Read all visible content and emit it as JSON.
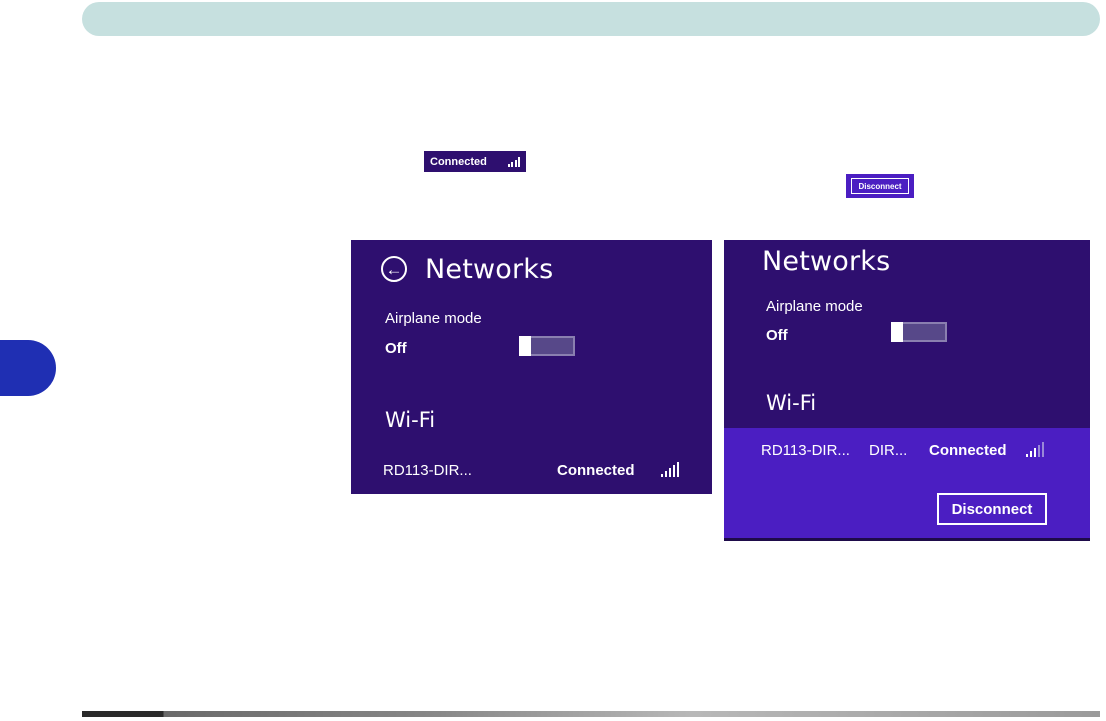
{
  "chips": {
    "connected_label": "Connected",
    "disconnect_label": "Disconnect"
  },
  "left_panel": {
    "title": "Networks",
    "back_icon": "back-arrow-circle-icon",
    "airplane_label": "Airplane mode",
    "airplane_state": "Off",
    "wifi_heading": "Wi-Fi",
    "network_name": "RD113-DIR...",
    "network_status": "Connected"
  },
  "right_panel": {
    "title": "Networks",
    "airplane_label": "Airplane mode",
    "airplane_state": "Off",
    "wifi_heading": "Wi-Fi",
    "network_name": "RD113-DIR...",
    "network_extra": "DIR...",
    "network_status": "Connected",
    "disconnect_label": "Disconnect"
  },
  "colors": {
    "panel_bg": "#2e0f6f",
    "selected_bg": "#4b1ec2",
    "header_bar": "#c6e0df",
    "side_tab": "#1f2fb3"
  }
}
